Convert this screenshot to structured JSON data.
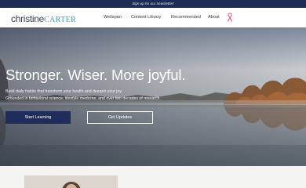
{
  "promo": {
    "text": "Sign up for our newsletter!"
  },
  "header": {
    "logo_first": "christine",
    "logo_last": "CARTER",
    "nav": [
      "Wellspan",
      "Content Library",
      "Recommended",
      "About"
    ],
    "ribbon_icon": "pink-ribbon-icon"
  },
  "hero": {
    "headline": "Stronger. Wiser. More joyful.",
    "subline_1": "Build daily habits that transform your health and deepen your joy.",
    "subline_2": "Grounded in behavioral science, lifestyle medicine, and over two decades of research.",
    "primary_button": "Start Learning",
    "secondary_button": "Get Updates"
  },
  "colors": {
    "navy": "#1d2b55",
    "teal": "#2fa4b3",
    "ribbon": "#e46a9a"
  }
}
